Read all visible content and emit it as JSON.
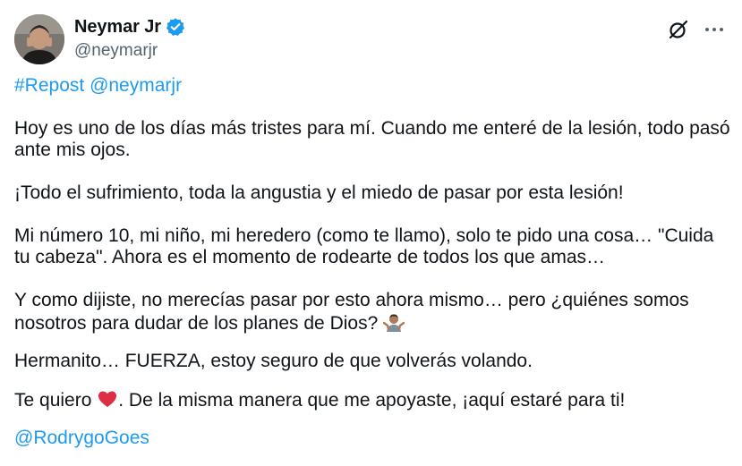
{
  "header": {
    "display_name": "Neymar Jr",
    "handle": "@neymarjr",
    "verified_icon": "verified-badge-icon",
    "grok_icon": "slash-circle-icon",
    "more_icon": "more-dots-icon"
  },
  "body": {
    "hashtag": "#Repost",
    "repost_mention": "@neymarjr",
    "p1": "Hoy es uno de los días más tristes para mí. Cuando me enteré de la lesión, todo pasó ante mis ojos.",
    "p2": "¡Todo el sufrimiento, toda la angustia y el miedo de pasar por esta lesión!",
    "p3": "Mi número 10, mi niño, mi heredero (como te llamo), solo te pido una cosa… \"Cuida tu cabeza\". Ahora es el momento de rodearte de todos los que amas…",
    "p4": "Y como dijiste, no merecías pasar por esto ahora mismo… pero ¿quiénes somos nosotros para dudar de los planes de Dios?",
    "p4_emoji": "person-shrugging-emoji",
    "p5": "Hermanito… FUERZA, estoy seguro de que volverás volando.",
    "p6_a": "Te quiero",
    "p6_emoji": "red-heart-emoji",
    "p6_b": ". De la misma manera que me apoyaste, ¡aquí estaré para ti!",
    "mention": "@RodrygoGoes"
  },
  "colors": {
    "text": "#0f1419",
    "secondary": "#536471",
    "link": "#1d9bf0"
  }
}
